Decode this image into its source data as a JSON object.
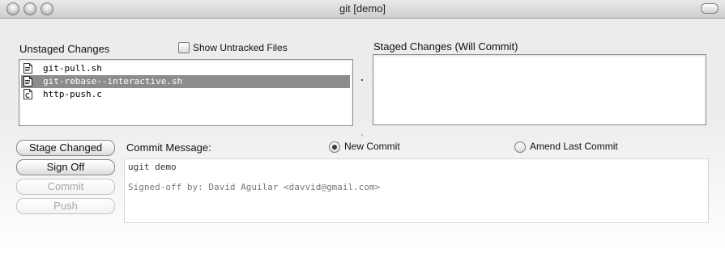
{
  "window": {
    "title": "git [demo]"
  },
  "unstaged": {
    "label": "Unstaged Changes",
    "show_untracked_label": "Show Untracked Files",
    "files": [
      {
        "name": "git-pull.sh",
        "selected": false
      },
      {
        "name": "git-rebase--interactive.sh",
        "selected": true
      },
      {
        "name": "http-push.c",
        "selected": false
      }
    ]
  },
  "staged": {
    "label": "Staged Changes (Will Commit)",
    "files": []
  },
  "buttons": {
    "stage_changed": "Stage Changed",
    "sign_off": "Sign Off",
    "commit": "Commit",
    "push": "Push"
  },
  "commit": {
    "label": "Commit Message:",
    "new_commit_label": "New Commit",
    "amend_label": "Amend Last Commit",
    "mode": "new_commit",
    "message_line_1": "ugit demo",
    "message_line_2": "Signed-off by: David Aguilar <davvid@gmail.com>"
  }
}
